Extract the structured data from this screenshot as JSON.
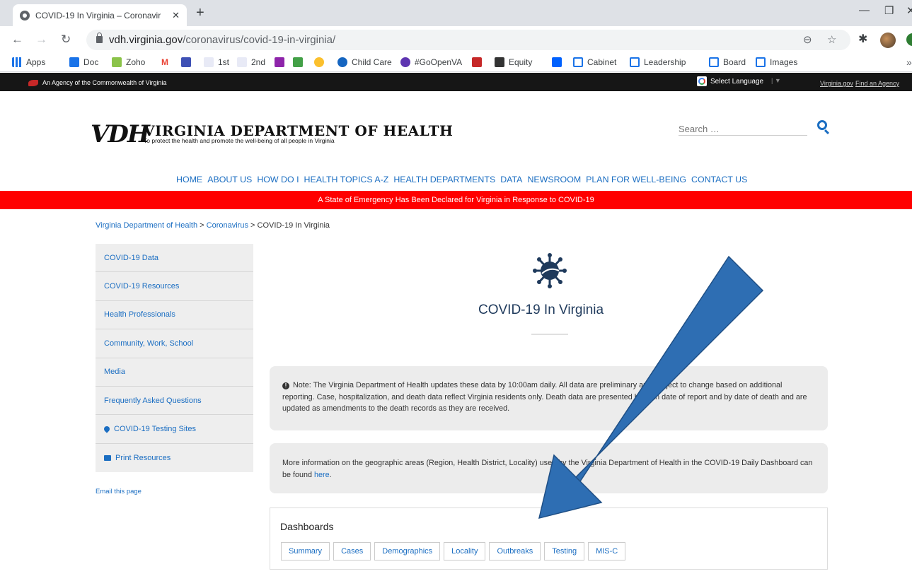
{
  "browser": {
    "tab_title": "COVID-19 In Virginia – Coronavir",
    "tab_close": "✕",
    "new_tab": "+",
    "url_host": "vdh.virginia.gov",
    "url_path": "/coronavirus/covid-19-in-virginia/",
    "icons": [
      "back-icon",
      "forward-icon",
      "reload-icon",
      "lock-icon",
      "zoom-icon",
      "star-icon",
      "extensions-icon"
    ],
    "bookmarks": [
      "Apps",
      "Doc",
      "Zoho",
      "1st",
      "2nd",
      "Child Care",
      "#GoOpenVA",
      "Equity",
      "Cabinet",
      "Leadership",
      "Board",
      "Images"
    ],
    "bookmark_more": "»"
  },
  "topbar": {
    "agency": "An Agency of the Commonwealth of Virginia",
    "select_language": "Select Language",
    "lang_sep": "| ▼",
    "link_virginia": "Virginia.gov",
    "link_find": "Find an Agency"
  },
  "header": {
    "logo_mark": "VDH",
    "logo_title": "VIRGINIA DEPARTMENT OF HEALTH",
    "tagline": "To protect the health and promote the well-being of all people in Virginia",
    "search_placeholder": "Search …"
  },
  "nav": [
    "HOME",
    "ABOUT US",
    "HOW DO I",
    "HEALTH TOPICS A-Z",
    "HEALTH DEPARTMENTS",
    "DATA",
    "NEWSROOM",
    "PLAN FOR WELL-BEING",
    "CONTACT US"
  ],
  "banner": "A State of Emergency Has Been Declared for Virginia in Response to COVID-19",
  "breadcrumb": {
    "home": "Virginia Department of Health",
    "sep": " > ",
    "section": "Coronavirus",
    "current": "COVID-19 In Virginia"
  },
  "sidebar": {
    "items": [
      "COVID-19 Data",
      "COVID-19 Resources",
      "Health Professionals",
      "Community, Work, School",
      "Media",
      "Frequently Asked Questions",
      "COVID-19 Testing Sites",
      "Print Resources"
    ],
    "email": "Email this page"
  },
  "content": {
    "title": "COVID-19 In Virginia",
    "note": "Note: The Virginia Department of Health updates these data by 10:00am daily. All data are preliminary and subject to change based on additional reporting. Case, hospitalization, and death data reflect Virginia residents only. Death data are presented by both date of report and by date of death and are updated as amendments to the death records as they are received.",
    "more_prefix": "More information on the geographic areas (Region, Health District, Locality) used by the Virginia Department of Health in the COVID-19 Daily Dashboard can be found ",
    "more_link": "here",
    "more_suffix": "."
  },
  "dashboards": {
    "title": "Dashboards",
    "tabs": [
      "Summary",
      "Cases",
      "Demographics",
      "Locality",
      "Outbreaks",
      "Testing",
      "MIS-C"
    ]
  },
  "colors": {
    "link": "#1b6ec2",
    "banner": "#ff0000",
    "arrow": "#2e6eb3"
  }
}
